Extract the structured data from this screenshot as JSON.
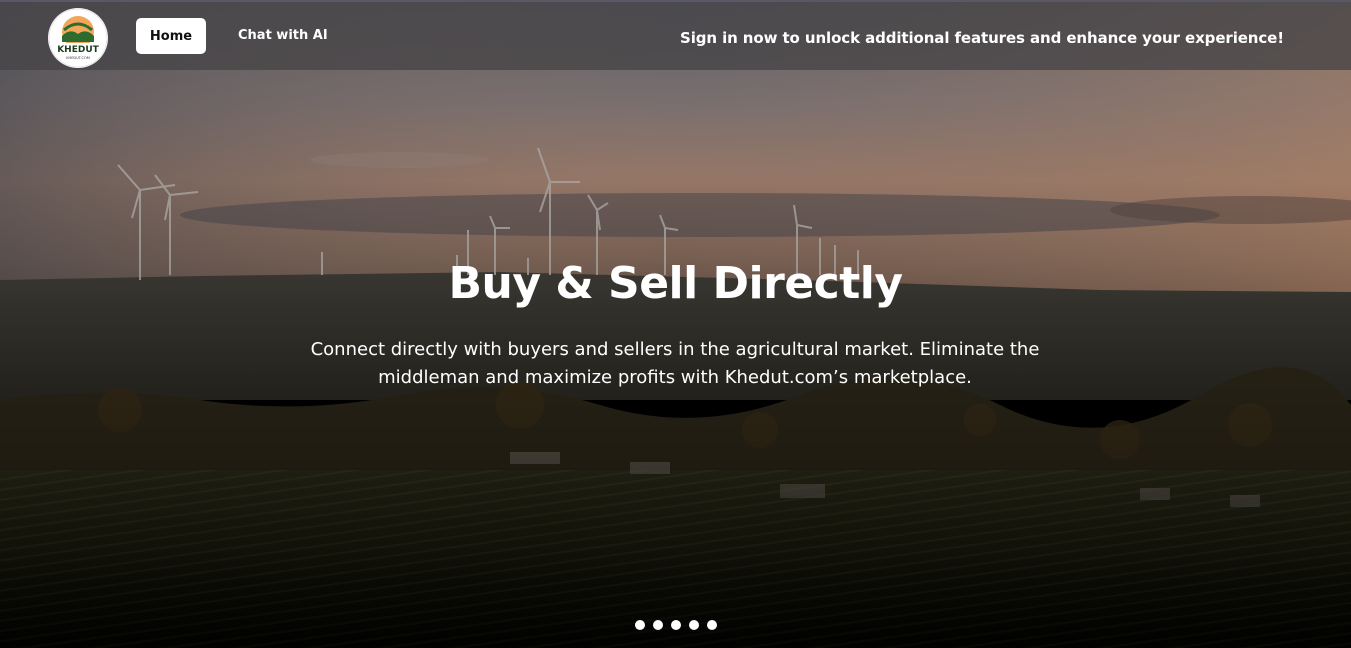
{
  "brand": {
    "logo_text": "KHEDUT",
    "logo_subtext": "KHEDUT.COM"
  },
  "nav": {
    "home_label": "Home",
    "chat_label": "Chat with AI",
    "signin_note": "Sign in now to unlock additional features and enhance your experience!"
  },
  "hero": {
    "title": "Buy & Sell Directly",
    "subtitle": "Connect directly with buyers and sellers in the agricultural market. Eliminate the middleman and maximize profits with Khedut.com’s marketplace.",
    "background_icon": "wind-farm-landscape-image"
  },
  "carousel": {
    "slide_count": 5,
    "dot_color": "#ffffff"
  },
  "colors": {
    "navbar_bg": "#464446",
    "accent_green": "#2e6b2e",
    "accent_orange": "#e0763a"
  }
}
